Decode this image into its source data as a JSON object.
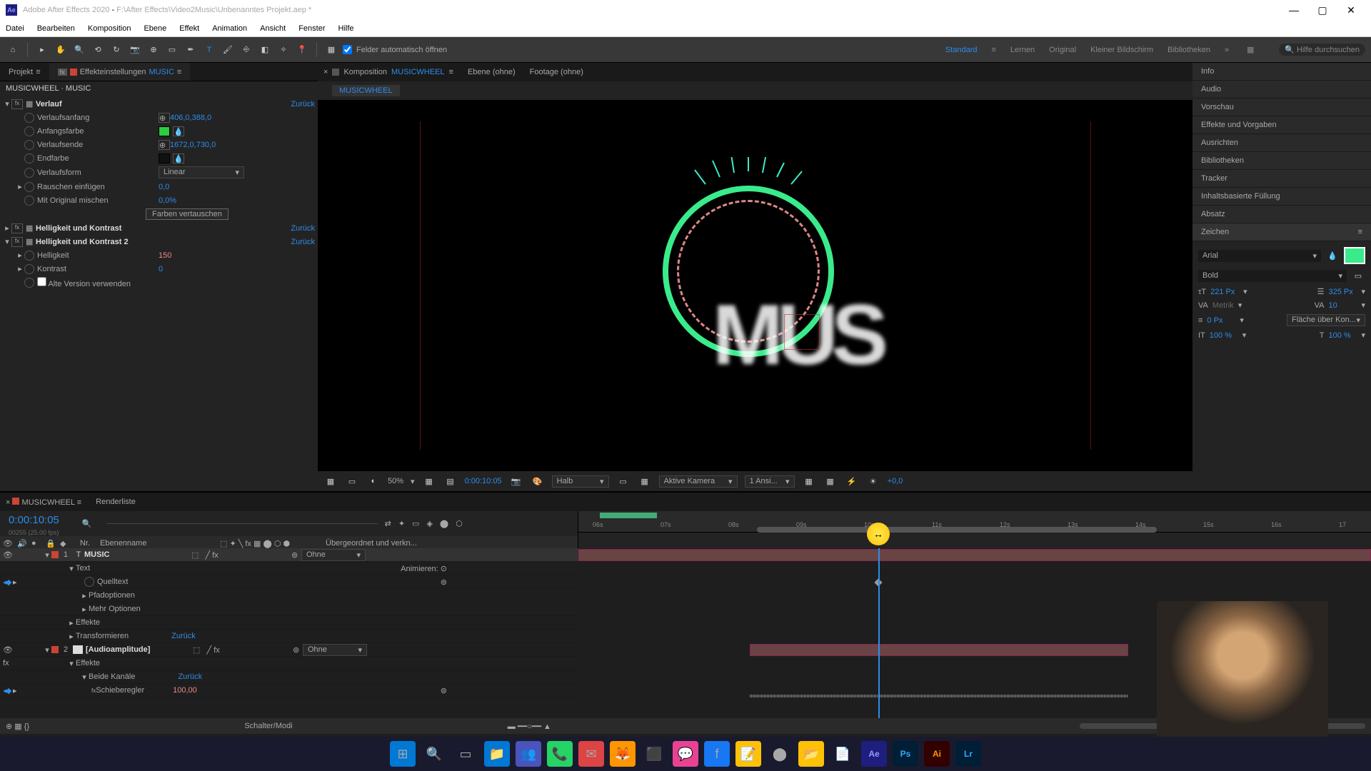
{
  "titlebar": {
    "app": "Adobe After Effects 2020",
    "path": "F:\\After Effects\\Video2Music\\Unbenanntes Projekt.aep *"
  },
  "menu": [
    "Datei",
    "Bearbeiten",
    "Komposition",
    "Ebene",
    "Effekt",
    "Animation",
    "Ansicht",
    "Fenster",
    "Hilfe"
  ],
  "toolbar": {
    "checkbox_label": "Felder automatisch öffnen",
    "workspaces": {
      "active": "Standard",
      "items": [
        "Lernen",
        "Original",
        "Kleiner Bildschirm",
        "Bibliotheken"
      ]
    },
    "search_placeholder": "Hilfe durchsuchen"
  },
  "left": {
    "tabs": {
      "project": "Projekt",
      "effects": "Effekteinstellungen",
      "effects_target": "MUSIC"
    },
    "breadcrumb": "MUSICWHEEL · MUSIC",
    "effects": [
      {
        "type": "fx",
        "name": "Verlauf",
        "reset": "Zurück",
        "open": true,
        "props": [
          {
            "name": "Verlaufsanfang",
            "val": "406,0,388,0",
            "swatch": null,
            "coord": true
          },
          {
            "name": "Anfangsfarbe",
            "swatch": "#2ecc40"
          },
          {
            "name": "Verlaufsende",
            "val": "1672,0,730,0",
            "coord": true
          },
          {
            "name": "Endfarbe",
            "swatch": "#111"
          },
          {
            "name": "Verlaufsform",
            "dropdown": "Linear"
          },
          {
            "name": "Rauschen einfügen",
            "val": "0,0",
            "twirl": true
          },
          {
            "name": "Mit Original mischen",
            "val": "0,0%"
          },
          {
            "button": "Farben vertauschen"
          }
        ]
      },
      {
        "type": "fx",
        "name": "Helligkeit und Kontrast",
        "reset": "Zurück",
        "open": false
      },
      {
        "type": "fx",
        "name": "Helligkeit und Kontrast 2",
        "reset": "Zurück",
        "open": true,
        "props": [
          {
            "name": "Helligkeit",
            "val": "150",
            "orange": true,
            "twirl": true
          },
          {
            "name": "Kontrast",
            "val": "0",
            "twirl": true
          },
          {
            "checkbox": "Alte Version verwenden"
          }
        ]
      }
    ]
  },
  "center": {
    "tabs": [
      {
        "label": "Komposition",
        "target": "MUSICWHEEL",
        "active": true
      },
      {
        "label": "Ebene (ohne)"
      },
      {
        "label": "Footage (ohne)"
      }
    ],
    "subtab": "MUSICWHEEL",
    "preview_text": "MUS",
    "controls": {
      "zoom": "50%",
      "timecode": "0:00:10:05",
      "res": "Halb",
      "camera": "Aktive Kamera",
      "views": "1 Ansi...",
      "exposure": "+0,0"
    }
  },
  "right": {
    "panels": [
      "Info",
      "Audio",
      "Vorschau",
      "Effekte und Vorgaben",
      "Ausrichten",
      "Bibliotheken",
      "Tracker",
      "Inhaltsbasierte Füllung",
      "Absatz"
    ],
    "char": {
      "title": "Zeichen",
      "font": "Arial",
      "style": "Bold",
      "size": "221 Px",
      "leading": "325 Px",
      "kerning": "Metrik",
      "tracking": "10",
      "stroke": "0 Px",
      "stroke_mode": "Fläche über Kon...",
      "vscale": "100 %",
      "hscale": "100 %"
    }
  },
  "timeline": {
    "tab": "MUSICWHEEL",
    "tab2": "Renderliste",
    "timecode": "0:00:10:05",
    "fps": "00255 (25.00 fps)",
    "cols": {
      "nr": "Nr.",
      "name": "Ebenenname",
      "parent": "Übergeordnet und verkn..."
    },
    "none_label": "Ohne",
    "animate_label": "Animieren:",
    "ticks": [
      "06s",
      "07s",
      "08s",
      "09s",
      "10s",
      "11s",
      "12s",
      "13s",
      "14s",
      "15s",
      "16s",
      "17"
    ],
    "layers": [
      {
        "num": "1",
        "name": "MUSIC",
        "type": "T",
        "color": "#c43",
        "children": [
          {
            "name": "Text",
            "children": [
              {
                "name": "Quelltext",
                "key": true
              },
              {
                "name": "Pfadoptionen",
                "twirl": true
              },
              {
                "name": "Mehr Optionen",
                "twirl": true
              }
            ]
          },
          {
            "name": "Effekte",
            "twirl": true
          },
          {
            "name": "Transformieren",
            "reset": "Zurück",
            "twirl": true
          }
        ]
      },
      {
        "num": "2",
        "name": "[Audioamplitude]",
        "type": "solid",
        "color": "#c43",
        "children": [
          {
            "name": "Effekte",
            "twirl": true,
            "children": [
              {
                "name": "Beide Kanäle",
                "reset": "Zurück",
                "children": [
                  {
                    "name": "Schieberegler",
                    "val": "100,00",
                    "fx": true
                  }
                ]
              }
            ]
          }
        ]
      }
    ],
    "footer": "Schalter/Modi"
  },
  "taskbar": {
    "icons": [
      "windows",
      "search",
      "tasks",
      "explorer",
      "teams",
      "whatsapp",
      "mail",
      "firefox",
      "app1",
      "messenger",
      "facebook",
      "notes",
      "obs",
      "folder",
      "editor",
      "ae",
      "ps",
      "ai",
      "lr",
      "more"
    ]
  }
}
